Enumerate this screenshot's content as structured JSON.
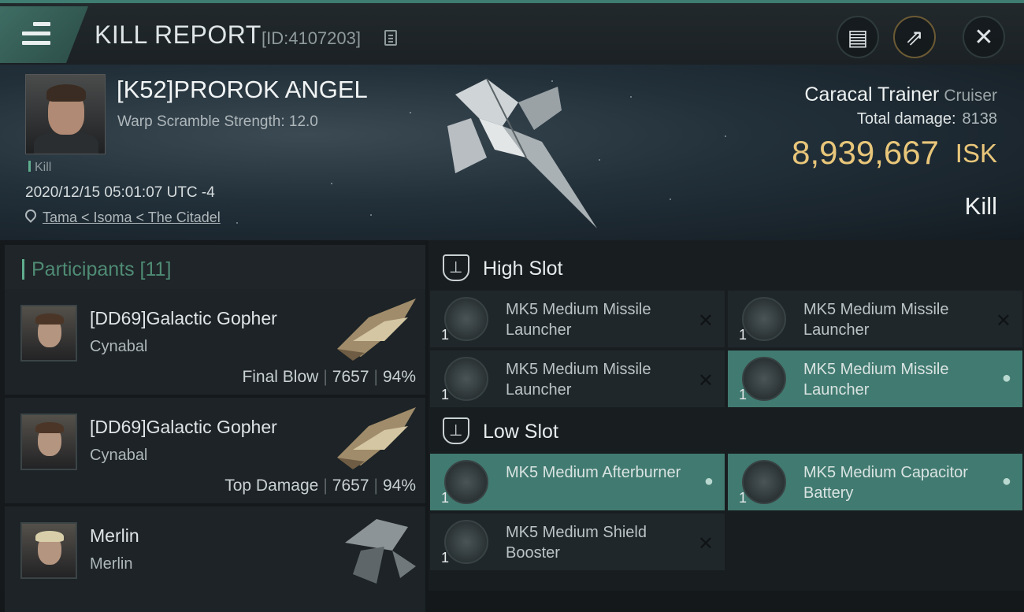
{
  "header": {
    "title": "KILL REPORT",
    "report_id": "[ID:4107203]"
  },
  "victim": {
    "name": "[K52]PROROK ANGEL",
    "warp_scramble": "Warp Scramble Strength: 12.0",
    "tag": "Kill",
    "timestamp": "2020/12/15 05:01:07 UTC -4",
    "location": "Tama < Isoma < The Citadel",
    "ship_name": "Caracal Trainer",
    "ship_class": "Cruiser",
    "total_damage_label": "Total damage:",
    "total_damage": "8138",
    "isk_value": "8,939,667",
    "isk_unit": "ISK",
    "result": "Kill"
  },
  "participants": {
    "header": "Participants [11]",
    "rows": [
      {
        "name": "[DD69]Galactic Gopher",
        "ship": "Cynabal",
        "role": "Final Blow",
        "damage": "7657",
        "percent": "94%"
      },
      {
        "name": "[DD69]Galactic Gopher",
        "ship": "Cynabal",
        "role": "Top Damage",
        "damage": "7657",
        "percent": "94%"
      },
      {
        "name": "Merlin",
        "ship": "Merlin",
        "role": "",
        "damage": "",
        "percent": ""
      }
    ]
  },
  "fitting": {
    "high_slot_label": "High Slot",
    "low_slot_label": "Low Slot",
    "high_modules": [
      {
        "name": "MK5 Medium Missile Launcher",
        "qty": "1",
        "status": "destroyed"
      },
      {
        "name": "MK5 Medium Missile Launcher",
        "qty": "1",
        "status": "destroyed"
      },
      {
        "name": "MK5 Medium Missile Launcher",
        "qty": "1",
        "status": "destroyed"
      },
      {
        "name": "MK5 Medium Missile Launcher",
        "qty": "1",
        "status": "dropped"
      }
    ],
    "low_modules": [
      {
        "name": "MK5 Medium Afterburner",
        "qty": "1",
        "status": "dropped"
      },
      {
        "name": "MK5 Medium Capacitor Battery",
        "qty": "1",
        "status": "dropped"
      },
      {
        "name": "MK5 Medium Shield Booster",
        "qty": "1",
        "status": "destroyed"
      }
    ]
  },
  "colors": {
    "accent": "#5fae8e",
    "isk": "#e8c67a",
    "dropped_bg": "#417a70"
  },
  "icons": [
    "menu-icon",
    "copy-icon",
    "notes-icon",
    "share-icon",
    "close-icon",
    "location-pin-icon",
    "high-slot-icon",
    "low-slot-icon",
    "destroyed-x-icon",
    "dropped-person-icon"
  ]
}
